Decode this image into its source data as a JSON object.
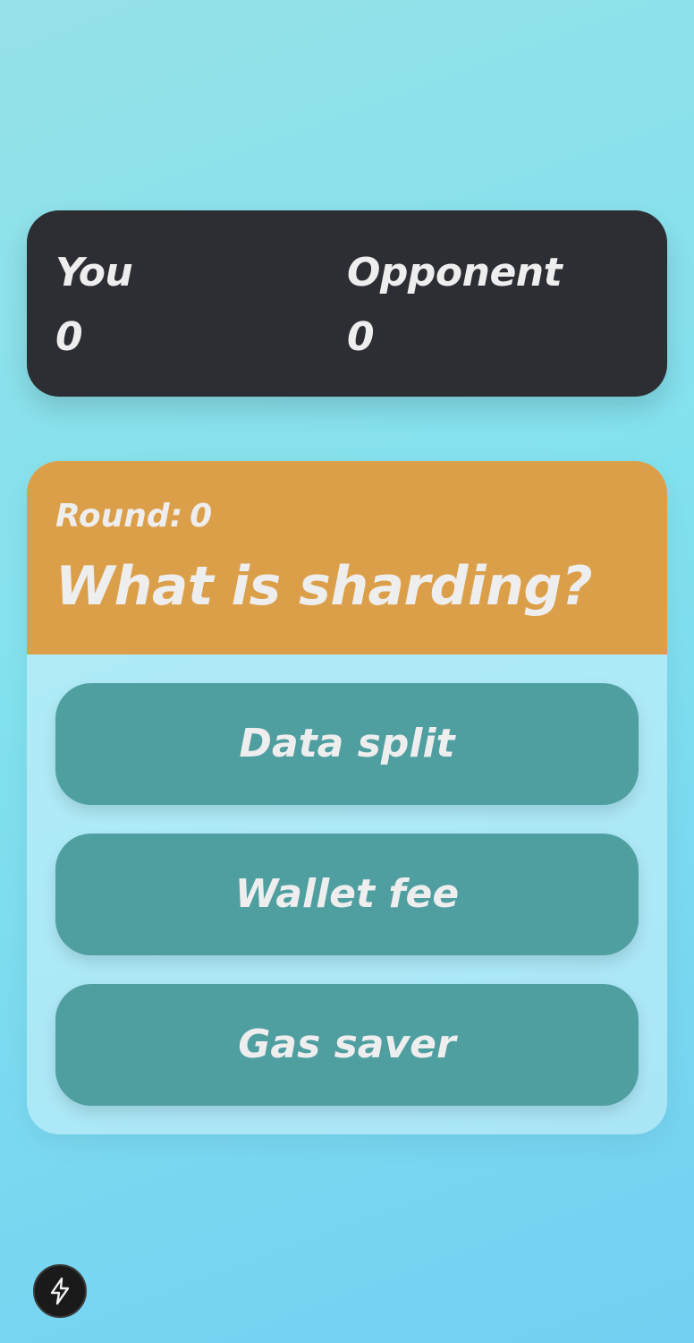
{
  "scoreboard": {
    "you": {
      "label": "You",
      "score": "0"
    },
    "opponent": {
      "label": "Opponent",
      "score": "0"
    }
  },
  "quiz": {
    "round_label": "Round:",
    "round_value": "0",
    "question": "What is sharding?",
    "answers": [
      "Data split",
      "Wallet fee",
      "Gas saver"
    ]
  },
  "colors": {
    "score_card": "#2d2e33",
    "header": "#dc9f49",
    "answer_button": "#4f9ea0",
    "text": "#eeeeee"
  },
  "icons": {
    "dev_badge": "lightning-bolt-icon"
  }
}
